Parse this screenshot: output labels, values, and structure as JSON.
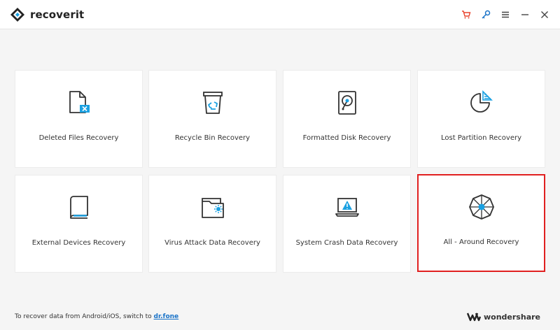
{
  "app": {
    "logo_text": "recoverit"
  },
  "toolbar": {
    "icons": [
      "cart-icon",
      "key-icon",
      "menu-icon",
      "minimize-icon",
      "close-icon"
    ],
    "cart_color": "#e8432d",
    "key_color": "#1a73c8"
  },
  "cards": [
    {
      "label": "Deleted Files Recovery",
      "icon": "deleted-file-icon"
    },
    {
      "label": "Recycle Bin Recovery",
      "icon": "recycle-bin-icon"
    },
    {
      "label": "Formatted Disk Recovery",
      "icon": "formatted-disk-icon"
    },
    {
      "label": "Lost Partition Recovery",
      "icon": "lost-partition-icon"
    },
    {
      "label": "External Devices Recovery",
      "icon": "external-device-icon"
    },
    {
      "label": "Virus Attack Data Recovery",
      "icon": "virus-folder-icon"
    },
    {
      "label": "System Crash Data Recovery",
      "icon": "system-crash-icon"
    },
    {
      "label": "All - Around Recovery",
      "icon": "all-around-icon",
      "selected": true
    }
  ],
  "footer": {
    "text": "To recover data from Android/iOS, switch to ",
    "link": "dr.fone"
  },
  "brand": {
    "text": "wondershare"
  },
  "colors": {
    "accent": "#1ba1e2",
    "selected_border": "#e02020"
  }
}
